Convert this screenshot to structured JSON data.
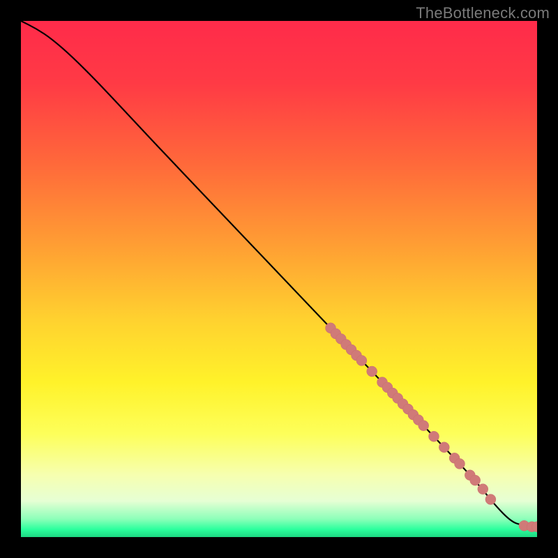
{
  "watermark": "TheBottleneck.com",
  "colors": {
    "gradient_stops": [
      {
        "offset": 0.0,
        "color": "#ff2b4a"
      },
      {
        "offset": 0.12,
        "color": "#ff3a45"
      },
      {
        "offset": 0.28,
        "color": "#ff6a3a"
      },
      {
        "offset": 0.44,
        "color": "#ffa033"
      },
      {
        "offset": 0.58,
        "color": "#ffd22f"
      },
      {
        "offset": 0.7,
        "color": "#fff22a"
      },
      {
        "offset": 0.8,
        "color": "#fdff5a"
      },
      {
        "offset": 0.88,
        "color": "#f6ffb0"
      },
      {
        "offset": 0.93,
        "color": "#e6ffd4"
      },
      {
        "offset": 0.965,
        "color": "#8cffb9"
      },
      {
        "offset": 0.985,
        "color": "#2bff9d"
      },
      {
        "offset": 1.0,
        "color": "#1dd883"
      }
    ],
    "curve": "#000000",
    "marker_fill": "#d07a78",
    "marker_stroke": "#c96f6d"
  },
  "chart_data": {
    "type": "line",
    "title": "",
    "xlabel": "",
    "ylabel": "",
    "x_range": [
      0,
      100
    ],
    "y_range": [
      0,
      100
    ],
    "curve_points": [
      {
        "x": 0.0,
        "y": 100.0
      },
      {
        "x": 3.0,
        "y": 98.5
      },
      {
        "x": 6.0,
        "y": 96.5
      },
      {
        "x": 10.0,
        "y": 93.0
      },
      {
        "x": 15.0,
        "y": 88.0
      },
      {
        "x": 22.0,
        "y": 80.5
      },
      {
        "x": 30.0,
        "y": 72.0
      },
      {
        "x": 40.0,
        "y": 61.5
      },
      {
        "x": 50.0,
        "y": 51.0
      },
      {
        "x": 60.0,
        "y": 40.5
      },
      {
        "x": 70.0,
        "y": 30.0
      },
      {
        "x": 80.0,
        "y": 19.5
      },
      {
        "x": 88.0,
        "y": 11.0
      },
      {
        "x": 92.0,
        "y": 6.0
      },
      {
        "x": 95.0,
        "y": 3.0
      },
      {
        "x": 97.0,
        "y": 2.3
      },
      {
        "x": 99.0,
        "y": 2.0
      },
      {
        "x": 100.0,
        "y": 2.0
      }
    ],
    "highlight_points": [
      {
        "x": 60.0,
        "y": 40.5
      },
      {
        "x": 61.0,
        "y": 39.4
      },
      {
        "x": 62.0,
        "y": 38.4
      },
      {
        "x": 63.0,
        "y": 37.3
      },
      {
        "x": 64.0,
        "y": 36.3
      },
      {
        "x": 65.0,
        "y": 35.2
      },
      {
        "x": 66.0,
        "y": 34.2
      },
      {
        "x": 68.0,
        "y": 32.1
      },
      {
        "x": 70.0,
        "y": 30.0
      },
      {
        "x": 71.0,
        "y": 29.0
      },
      {
        "x": 72.0,
        "y": 27.9
      },
      {
        "x": 73.0,
        "y": 26.9
      },
      {
        "x": 74.0,
        "y": 25.8
      },
      {
        "x": 75.0,
        "y": 24.8
      },
      {
        "x": 76.0,
        "y": 23.7
      },
      {
        "x": 77.0,
        "y": 22.7
      },
      {
        "x": 78.0,
        "y": 21.6
      },
      {
        "x": 80.0,
        "y": 19.5
      },
      {
        "x": 82.0,
        "y": 17.4
      },
      {
        "x": 84.0,
        "y": 15.3
      },
      {
        "x": 85.0,
        "y": 14.2
      },
      {
        "x": 87.0,
        "y": 12.0
      },
      {
        "x": 88.0,
        "y": 11.0
      },
      {
        "x": 89.5,
        "y": 9.3
      },
      {
        "x": 91.0,
        "y": 7.3
      },
      {
        "x": 97.5,
        "y": 2.2
      },
      {
        "x": 99.0,
        "y": 2.0
      },
      {
        "x": 100.0,
        "y": 2.0
      }
    ]
  }
}
